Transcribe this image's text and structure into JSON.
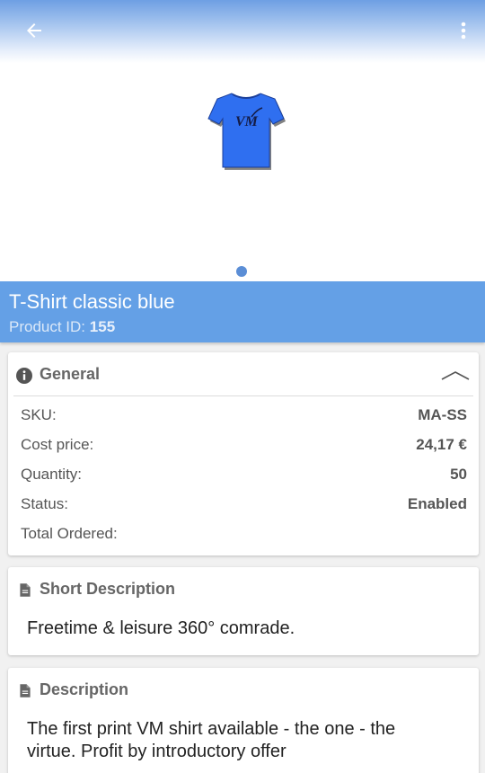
{
  "product": {
    "name": "T-Shirt classic blue",
    "id_label": "Product ID:",
    "id_value": "155",
    "image_logo_text": "VM"
  },
  "appbar": {
    "back_icon": "arrow-left-icon",
    "more_icon": "more-vertical-icon"
  },
  "general": {
    "title": "General",
    "icon": "info-icon",
    "rows": [
      {
        "label": "SKU:",
        "value": "MA-SS"
      },
      {
        "label": "Cost price:",
        "value": "24,17 €"
      },
      {
        "label": "Quantity:",
        "value": "50"
      },
      {
        "label": "Status:",
        "value": "Enabled"
      },
      {
        "label": "Total Ordered:",
        "value": ""
      }
    ]
  },
  "short_description": {
    "title": "Short Description",
    "icon": "document-icon",
    "text": "Freetime & leisure 360° comrade."
  },
  "description": {
    "title": "Description",
    "icon": "document-icon",
    "text": "The first print VM shirt available - the one - the virtue. Profit by introductory offer"
  },
  "colors": {
    "accent": "#64a0e6",
    "dot": "#5b8ed6",
    "shirt": "#2f6ff0"
  }
}
